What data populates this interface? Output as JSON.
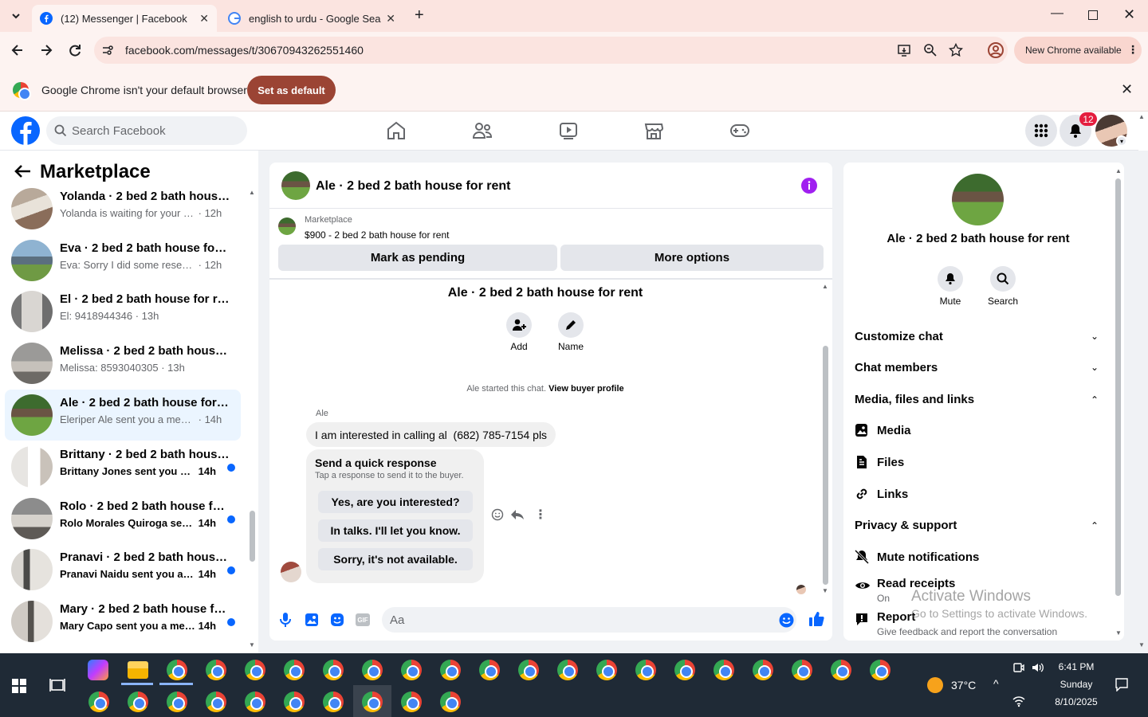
{
  "browser": {
    "tabs": [
      {
        "title": "(12) Messenger | Facebook",
        "active": true
      },
      {
        "title": "english to urdu - Google Search",
        "active": false
      }
    ],
    "url": "facebook.com/messages/t/30670943262551460",
    "new_chrome": "New Chrome available",
    "infobar_text": "Google Chrome isn't your default browser",
    "set_default": "Set as default"
  },
  "fb": {
    "search_placeholder": "Search Facebook",
    "notification_count": "12"
  },
  "sidebar": {
    "title": "Marketplace",
    "conversations": [
      {
        "name": "Yolanda · 2 bed 2 bath house fo...",
        "preview": "Yolanda is waiting for your respo...",
        "time": "· 12h",
        "unread": false
      },
      {
        "name": "Eva · 2 bed 2 bath house for rent",
        "preview": "Eva: Sorry I did some research I'm...",
        "time": "· 12h",
        "unread": false
      },
      {
        "name": "El · 2 bed 2 bath house for rent",
        "preview": "El: 9418944346",
        "time": "· 13h",
        "unread": false
      },
      {
        "name": "Melissa · 2 bed 2 bath house for...",
        "preview": "Melissa: 8593040305",
        "time": "· 13h",
        "unread": false
      },
      {
        "name": "Ale · 2 bed 2 bath house for rent",
        "preview": "Eleriper Ale sent you a message a...",
        "time": "· 14h",
        "unread": false,
        "selected": true
      },
      {
        "name": "Brittany · 2 bed 2 bath house f...",
        "preview": "Brittany Jones sent you a mess...",
        "time": "14h",
        "unread": true
      },
      {
        "name": "Rolo · 2 bed 2 bath house for r...",
        "preview": "Rolo Morales Quiroga sent yo...",
        "time": "14h",
        "unread": true
      },
      {
        "name": "Pranavi · 2 bed 2 bath house f...",
        "preview": "Pranavi Naidu sent you a mess...",
        "time": "14h",
        "unread": true
      },
      {
        "name": "Mary · 2 bed 2 bath house for ...",
        "preview": "Mary Capo sent you a messag...",
        "time": "14h",
        "unread": true
      }
    ]
  },
  "chat": {
    "header_title": "Ale · 2 bed 2 bath house for rent",
    "listing_source": "Marketplace",
    "listing_price": "$900 - 2 bed 2 bath house for rent",
    "mark_pending": "Mark as pending",
    "more_options": "More options",
    "center_title": "Ale · 2 bed 2 bath house for rent",
    "add_label": "Add",
    "name_label": "Name",
    "started_text": "Ale started this chat.",
    "view_profile": "View buyer profile",
    "sender": "Ale",
    "message": "I am interested in calling al  (682) 785-7154 pls",
    "quick_title": "Send a quick response",
    "quick_sub": "Tap a response to send it to the buyer.",
    "quick_responses": [
      "Yes, are you interested?",
      "In talks. I'll let you know.",
      "Sorry, it's not available."
    ],
    "composer_placeholder": "Aa",
    "gif_label": "GIF"
  },
  "details": {
    "title": "Ale · 2 bed 2 bath house for rent",
    "mute": "Mute",
    "search": "Search",
    "sections": {
      "customize": "Customize chat",
      "members": "Chat members",
      "media_files": "Media, files and links",
      "privacy": "Privacy & support"
    },
    "media": "Media",
    "files": "Files",
    "links": "Links",
    "mute_notifications": "Mute notifications",
    "read_receipts": "Read receipts",
    "read_receipts_state": "On",
    "report": "Report",
    "report_sub": "Give feedback and report the conversation"
  },
  "watermark": {
    "title": "Activate Windows",
    "sub": "Go to Settings to activate Windows."
  },
  "taskbar": {
    "temperature": "37°C",
    "time": "6:41 PM",
    "day": "Sunday",
    "date": "8/10/2025"
  }
}
